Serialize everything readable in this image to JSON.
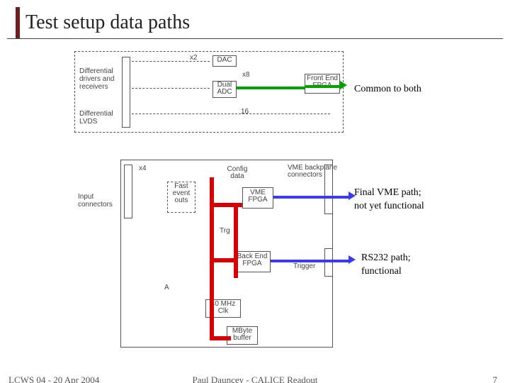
{
  "title": "Test setup data paths",
  "footer": {
    "left": "LCWS 04 - 20 Apr 2004",
    "center": "Paul Dauncey - CALICE Readout",
    "right": "7"
  },
  "annotations": {
    "common": "Common to both",
    "vme_line1": "Final VME path;",
    "vme_line2": "not yet functional",
    "rs232_line1": "RS232 path;",
    "rs232_line2": "functional"
  },
  "diagram_labels": {
    "diff_drivers": "Differential\ndrivers and\nreceivers",
    "diff_lvds": "Differential\nLVDS",
    "dac": "DAC",
    "x2": "x2",
    "x8": "x8",
    "dual_adc": "Dual\nADC",
    "sixteen": "16",
    "front_fpga": "Front End\nFPGA",
    "input_conn": "Input\nconnectors",
    "x4": "x4",
    "fast_event": "Fast\nevent\nouts",
    "config_data": "Config\ndata",
    "vme_fpga": "VME\nFPGA",
    "vme_back": "VME backplane\nconnectors",
    "trg": "Trg",
    "back_fpga": "Back End\nFPGA",
    "trigger": "Trigger",
    "a": "A",
    "clk40": "40 MHz\nClk",
    "mbuf": "MByte\nbuffer"
  }
}
